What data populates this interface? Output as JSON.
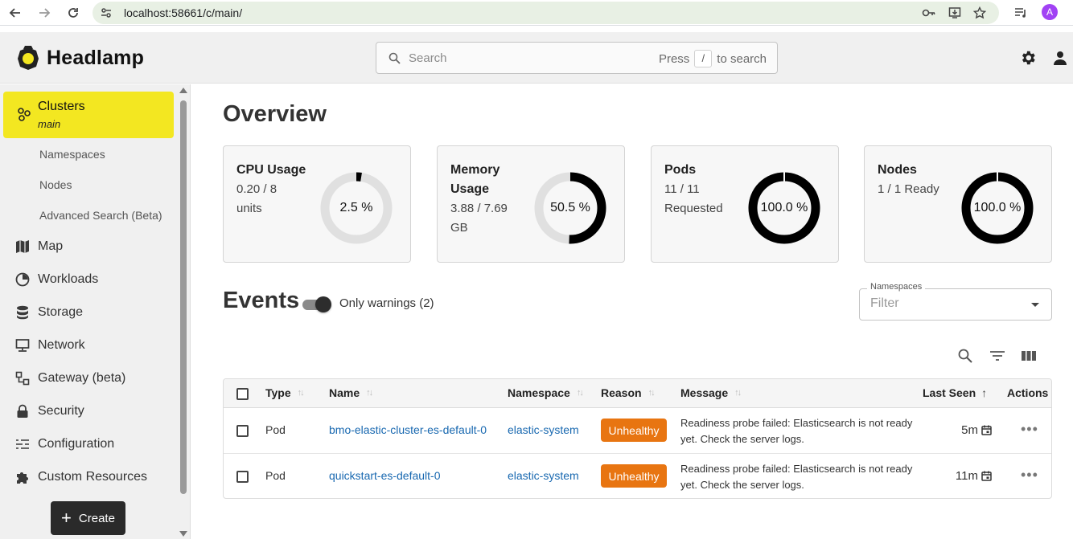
{
  "browser": {
    "url": "localhost:58661/c/main/",
    "profile_initial": "A",
    "icons": [
      "back-arrow-icon",
      "forward-arrow-icon",
      "reload-icon",
      "site-info-icon",
      "password-key-icon",
      "install-app-icon",
      "bookmark-star-icon",
      "reading-list-icon"
    ]
  },
  "header": {
    "brand": "Headlamp",
    "search": {
      "placeholder": "Search",
      "hint_before": "Press",
      "hint_key": "/",
      "hint_after": "to search"
    },
    "icons": [
      "settings-gear-icon",
      "user-account-icon"
    ]
  },
  "sidebar": {
    "cluster": {
      "label": "Clusters",
      "name": "main"
    },
    "subitems": [
      "Namespaces",
      "Nodes",
      "Advanced Search (Beta)"
    ],
    "items": [
      {
        "label": "Map",
        "icon": "map-icon"
      },
      {
        "label": "Workloads",
        "icon": "workloads-pie-icon"
      },
      {
        "label": "Storage",
        "icon": "storage-database-icon"
      },
      {
        "label": "Network",
        "icon": "network-monitor-icon"
      },
      {
        "label": "Gateway (beta)",
        "icon": "gateway-icon"
      },
      {
        "label": "Security",
        "icon": "lock-icon"
      },
      {
        "label": "Configuration",
        "icon": "configuration-list-icon"
      },
      {
        "label": "Custom Resources",
        "icon": "puzzle-piece-icon"
      }
    ],
    "create_label": "Create"
  },
  "overview": {
    "title": "Overview",
    "cards": [
      {
        "title": "CPU Usage",
        "lines": [
          "0.20 / 8",
          "units"
        ],
        "percent_label": "2.5 %",
        "fraction": 0.025
      },
      {
        "title": "Memory Usage",
        "lines": [
          "3.88 / 7.69",
          "GB"
        ],
        "percent_label": "50.5 %",
        "fraction": 0.505
      },
      {
        "title": "Pods",
        "lines": [
          "11 / 11",
          "Requested"
        ],
        "percent_label": "100.0 %",
        "fraction": 1.0
      },
      {
        "title": "Nodes",
        "lines": [
          "1 / 1 Ready"
        ],
        "percent_label": "100.0 %",
        "fraction": 1.0
      }
    ]
  },
  "events": {
    "title": "Events",
    "toggle_label": "Only warnings (2)",
    "toggle_on": true,
    "namespace_filter": {
      "label": "Namespaces",
      "placeholder": "Filter"
    },
    "toolbar_icons": [
      "search-icon",
      "filter-icon",
      "columns-icon"
    ],
    "columns": [
      "Type",
      "Name",
      "Namespace",
      "Reason",
      "Message",
      "Last Seen",
      "Actions"
    ],
    "rows": [
      {
        "type": "Pod",
        "name": "bmo-elastic-cluster-es-default-0",
        "namespace": "elastic-system",
        "reason": "Unhealthy",
        "message": "Readiness probe failed: Elasticsearch is not ready yet. Check the server logs.",
        "last_seen": "5m"
      },
      {
        "type": "Pod",
        "name": "quickstart-es-default-0",
        "namespace": "elastic-system",
        "reason": "Unhealthy",
        "message": "Readiness probe failed: Elasticsearch is not ready yet. Check the server logs.",
        "last_seen": "11m"
      }
    ]
  },
  "colors": {
    "accent_yellow": "#f3e721",
    "badge_orange": "#e87511",
    "link_blue": "#1868b0",
    "donut_fill": "#000000",
    "donut_track": "#e0e0e0"
  }
}
